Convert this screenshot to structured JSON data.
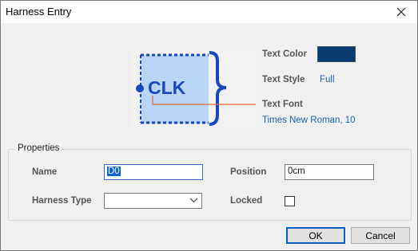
{
  "window": {
    "title": "Harness Entry"
  },
  "preview": {
    "label": "CLK"
  },
  "text_props": {
    "color_label": "Text Color",
    "color_value": "#0a3b6f",
    "style_label": "Text Style",
    "style_value": "Full",
    "font_label": "Text Font",
    "font_value": "Times New Roman, 10"
  },
  "properties": {
    "title": "Properties",
    "name_label": "Name",
    "name_value": "D0",
    "position_label": "Position",
    "position_value": "0cm",
    "harness_type_label": "Harness Type",
    "harness_type_value": "",
    "locked_label": "Locked",
    "locked_checked": false
  },
  "buttons": {
    "ok": "OK",
    "cancel": "Cancel"
  },
  "icons": {
    "close": "close-icon",
    "dropdown": "chevron-down-icon"
  }
}
